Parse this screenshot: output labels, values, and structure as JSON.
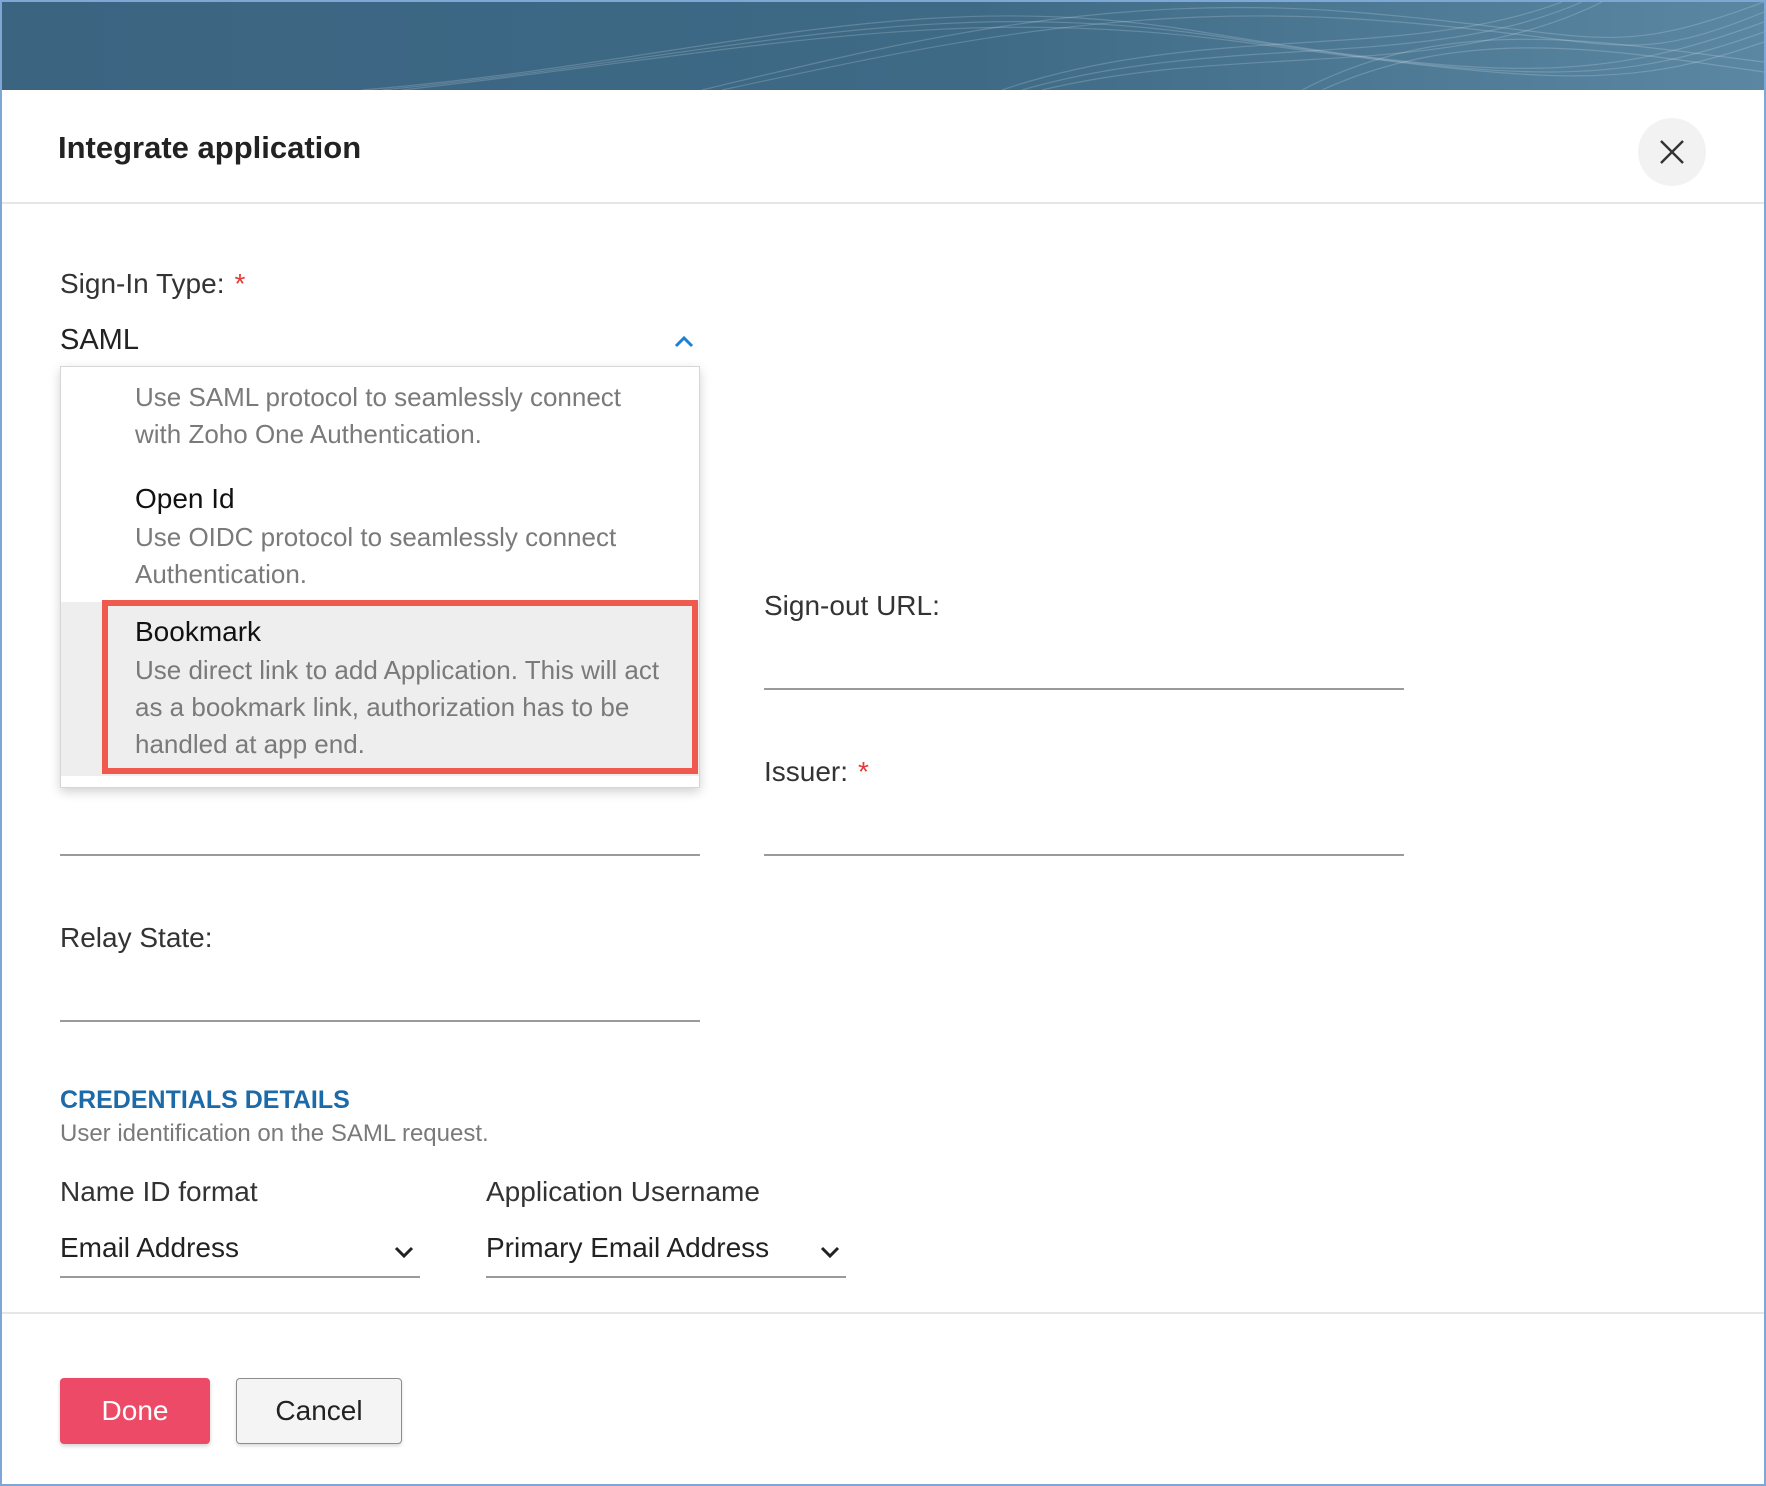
{
  "dialog": {
    "title": "Integrate application"
  },
  "sign_in": {
    "label": "Sign-In Type:",
    "required_mark": "*",
    "selected_value": "SAML",
    "options": [
      {
        "title": "",
        "description_lines": [
          "Use SAML protocol to seamlessly connect",
          "with Zoho One Authentication."
        ]
      },
      {
        "title": "Open Id",
        "description_lines": [
          "Use OIDC protocol to seamlessly connect",
          "Authentication."
        ]
      },
      {
        "title": "Bookmark",
        "description_lines": [
          "Use direct link to add Application. This will act",
          "as a bookmark link, authorization has to be",
          "handled at app end."
        ]
      }
    ]
  },
  "fields": {
    "sign_out_url_label": "Sign-out URL:",
    "issuer_label": "Issuer:",
    "issuer_required": "*",
    "relay_state_label": "Relay State:"
  },
  "credentials": {
    "heading": "CREDENTIALS DETAILS",
    "subtitle": "User identification on the SAML request.",
    "name_id_label": "Name ID format",
    "name_id_value": "Email Address",
    "username_label": "Application Username",
    "username_value": "Primary Email Address"
  },
  "footer": {
    "done_label": "Done",
    "cancel_label": "Cancel"
  },
  "icons": {
    "close": "close-icon",
    "chevron_up": "chevron-up-icon",
    "chevron_down": "chevron-down-icon"
  },
  "colors": {
    "banner": "#3e6a86",
    "accent_blue": "#1d6aa8",
    "required_red": "#e53935",
    "done_button": "#ec4a66",
    "highlight": "#f05a4e"
  }
}
